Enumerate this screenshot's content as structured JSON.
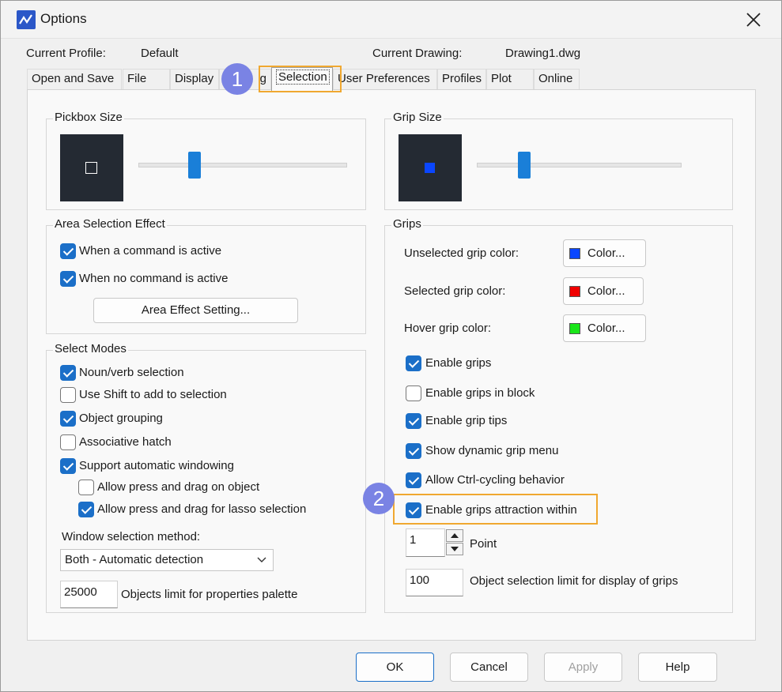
{
  "window": {
    "title": "Options"
  },
  "header": {
    "profile_label": "Current Profile:",
    "profile_value": "Default",
    "drawing_label": "Current Drawing:",
    "drawing_value": "Drawing1.dwg"
  },
  "tabs": [
    "Open and Save",
    "File",
    "Display",
    "g",
    "Selection",
    "User Preferences",
    "Profiles",
    "Plot",
    "Online"
  ],
  "pickbox": {
    "title": "Pickbox Size",
    "slider_level": 0.27
  },
  "grip_size": {
    "title": "Grip Size",
    "slider_level": 0.23
  },
  "area_selection": {
    "title": "Area Selection Effect",
    "items": [
      "When a command is active",
      "When no command is active"
    ],
    "button": "Area Effect Setting..."
  },
  "select_modes": {
    "title": "Select Modes",
    "items": [
      "Noun/verb selection",
      "Use Shift to add to selection",
      "Object grouping",
      "Associative hatch",
      "Support automatic windowing",
      "Allow press and drag on object",
      "Allow press and drag for lasso selection"
    ],
    "window_method_label": "Window selection method:",
    "window_method_value": "Both - Automatic detection",
    "objects_limit_value": "25000",
    "objects_limit_label": "Objects limit for properties palette"
  },
  "grips": {
    "title": "Grips",
    "unselected_label": "Unselected grip color:",
    "selected_label": "Selected grip color:",
    "hover_label": "Hover grip color:",
    "color_button": "Color...",
    "items": [
      "Enable grips",
      "Enable grips in block",
      "Enable grip tips",
      "Show dynamic grip menu",
      "Allow Ctrl-cycling behavior",
      "Enable grips attraction within"
    ],
    "point_value": "1",
    "point_label": "Point",
    "limit_value": "100",
    "limit_label": "Object selection limit for display of grips"
  },
  "footer": {
    "ok": "OK",
    "cancel": "Cancel",
    "apply": "Apply",
    "help": "Help"
  },
  "annotations": [
    "1",
    "2"
  ],
  "colors": {
    "unselected": "#0a46ff",
    "selected": "#f00000",
    "hover": "#19e619",
    "accent": "#1b6fc8",
    "highlight": "#f0a830",
    "badge": "#7a83e4"
  }
}
